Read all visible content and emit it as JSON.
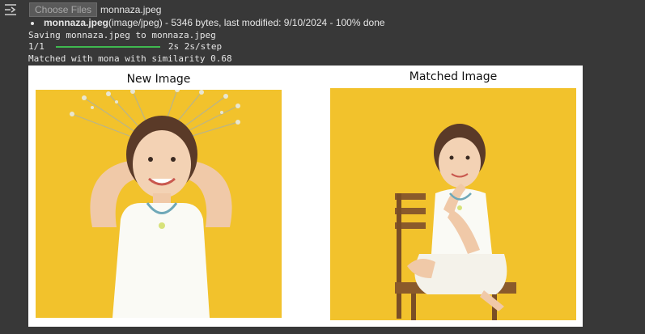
{
  "output": {
    "choose_files_label": "Choose Files",
    "selected_file": "monnaza.jpeg",
    "file_name": "monnaza.jpeg",
    "file_details": "(image/jpeg) - 5346 bytes, last modified: 9/10/2024 - 100% done",
    "saving_line": "Saving monnaza.jpeg to monnaza.jpeg",
    "progress_step": "1/1",
    "progress_fraction": 1.0,
    "progress_time": "2s 2s/step",
    "match_line": "Matched with mona with similarity 0.68"
  },
  "figure": {
    "left_title": "New Image",
    "right_title": "Matched Image",
    "left_image": "girl-with-hands-behind-head-yellow-background-photo",
    "right_image": "girl-seated-on-wooden-chair-yellow-background-photo"
  },
  "colors": {
    "background": "#383838",
    "progress": "#3fb950",
    "photo_background": "#f2c22c"
  }
}
